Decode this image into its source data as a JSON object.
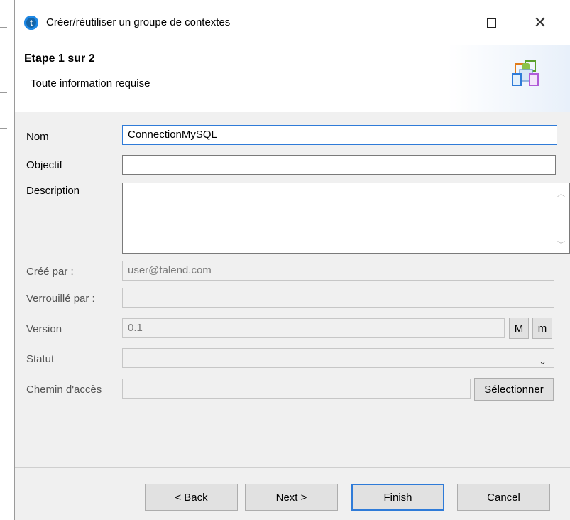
{
  "window": {
    "title": "Créer/réutiliser un groupe de contextes",
    "app_icon_glyph": "t"
  },
  "header": {
    "step_title": "Etape 1 sur 2",
    "step_subtitle": "Toute information requise",
    "icon": "context-group-icon"
  },
  "form": {
    "nom": {
      "label": "Nom",
      "value": "ConnectionMySQL"
    },
    "objectif": {
      "label": "Objectif",
      "value": ""
    },
    "description": {
      "label": "Description",
      "value": ""
    },
    "cree_par": {
      "label": "Créé par :",
      "value": "user@talend.com"
    },
    "verrouille_par": {
      "label": "Verrouillé par :",
      "value": ""
    },
    "version": {
      "label": "Version",
      "value": "0.1",
      "major_button": "M",
      "minor_button": "m"
    },
    "statut": {
      "label": "Statut",
      "value": ""
    },
    "chemin": {
      "label": "Chemin d'accès",
      "value": "",
      "button": "Sélectionner"
    }
  },
  "buttons": {
    "back": "< Back",
    "next": "Next >",
    "finish": "Finish",
    "cancel": "Cancel"
  },
  "colors": {
    "accent": "#2f7bd8",
    "dialog_bg": "#f0f0f0"
  }
}
